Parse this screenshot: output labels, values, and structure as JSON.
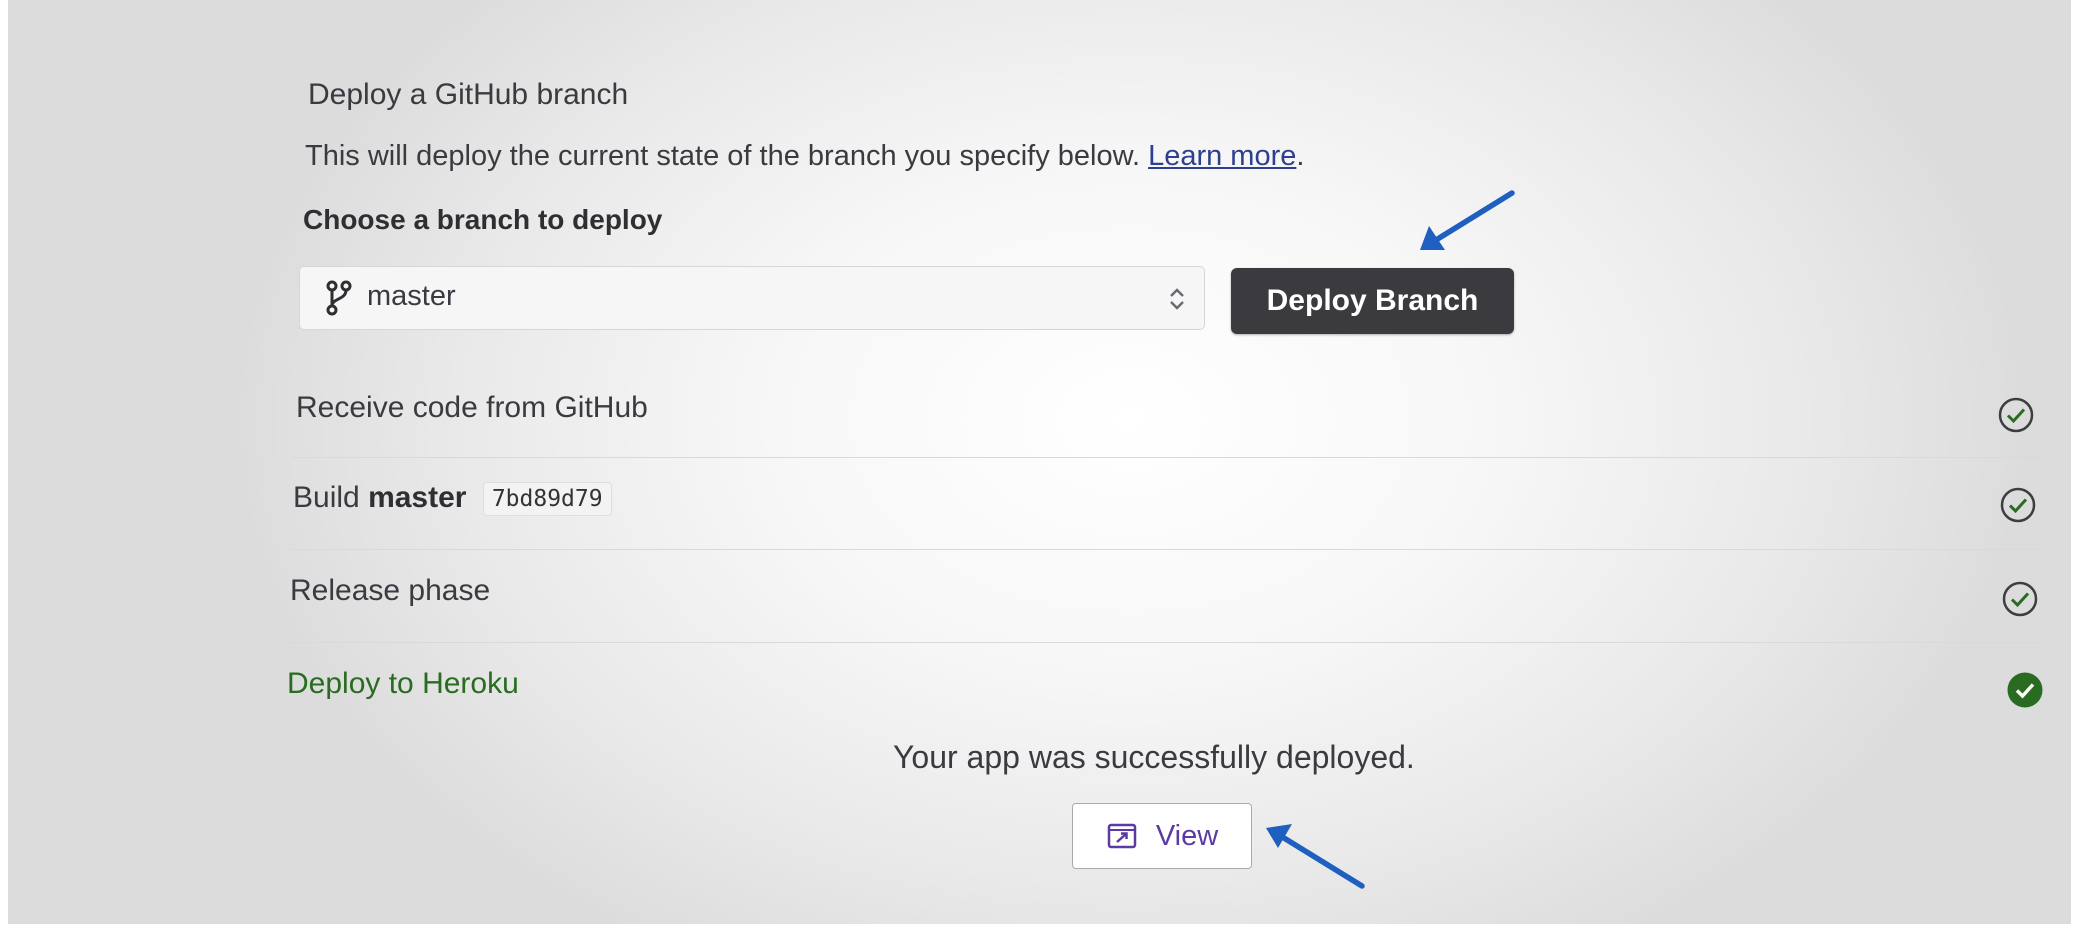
{
  "deploy_section": {
    "title": "Deploy a GitHub branch",
    "description": "This will deploy the current state of the branch you specify below.",
    "learn_more_link": "Learn more",
    "description_end": ".",
    "branch_field_label": "Choose a branch to deploy",
    "selected_branch": "master",
    "deploy_button_label": "Deploy Branch"
  },
  "steps": [
    {
      "label": "Receive code from GitHub",
      "status": "complete"
    },
    {
      "label_prefix": "Build",
      "branch": "master",
      "commit": "7bd89d79",
      "status": "complete"
    },
    {
      "label": "Release phase",
      "status": "complete"
    },
    {
      "label": "Deploy to Heroku",
      "status": "success"
    }
  ],
  "result": {
    "message": "Your app was successfully deployed.",
    "view_button_label": "View"
  },
  "icons": {
    "branch": "git-branch-icon",
    "select": "chevron-up-down-icon",
    "step_complete": "check-circle-outline-icon",
    "step_success": "check-circle-filled-icon",
    "view": "external-link-icon",
    "annotation": "arrow-annotation"
  },
  "colors": {
    "deploy_button_bg": "#3b3b3f",
    "success_green": "#2a6b22",
    "link_blue": "#2d3f8f",
    "view_purple": "#5b3aa3",
    "annotation_arrow": "#1f5fbf"
  }
}
